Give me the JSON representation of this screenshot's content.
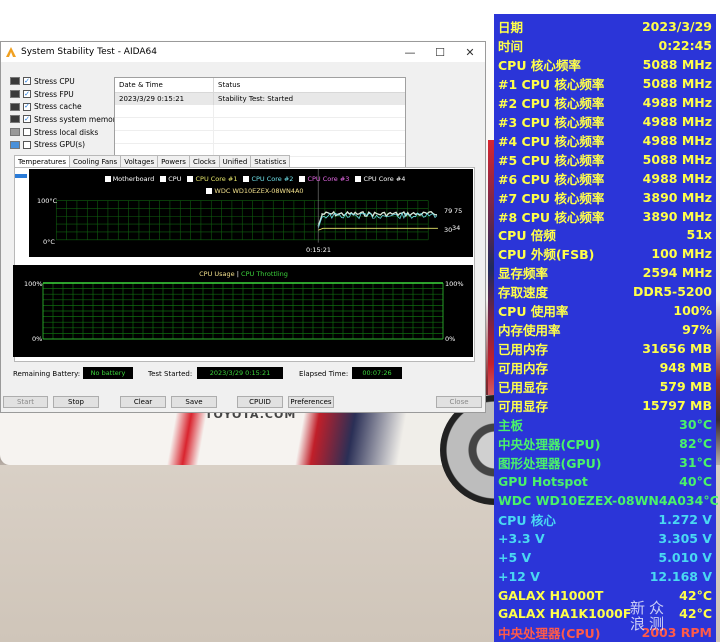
{
  "window": {
    "title": "System Stability Test - AIDA64",
    "controls": [
      "—",
      "☐",
      "✕"
    ]
  },
  "stress_options": [
    {
      "label": "Stress CPU",
      "checked": true,
      "icon": "cpu-chip-icon"
    },
    {
      "label": "Stress FPU",
      "checked": true,
      "icon": "fpu-chip-icon"
    },
    {
      "label": "Stress cache",
      "checked": true,
      "icon": "cache-chip-icon"
    },
    {
      "label": "Stress system memory",
      "checked": true,
      "icon": "memory-module-icon"
    },
    {
      "label": "Stress local disks",
      "checked": false,
      "icon": "disk-drive-icon"
    },
    {
      "label": "Stress GPU(s)",
      "checked": false,
      "icon": "monitor-icon"
    }
  ],
  "status_table": {
    "col_datetime": "Date & Time",
    "col_status": "Status",
    "rows": [
      {
        "datetime": "2023/3/29 0:15:21",
        "status": "Stability Test: Started"
      }
    ]
  },
  "tabs": [
    "Temperatures",
    "Cooling Fans",
    "Voltages",
    "Powers",
    "Clocks",
    "Unified",
    "Statistics"
  ],
  "temp_graph": {
    "legend": [
      {
        "label": "Motherboard",
        "color": "#ffffff"
      },
      {
        "label": "CPU",
        "color": "#ffffff"
      },
      {
        "label": "CPU Core #1",
        "color": "#e8e86a"
      },
      {
        "label": "CPU Core #2",
        "color": "#6ee0e8"
      },
      {
        "label": "CPU Core #3",
        "color": "#e86ae8"
      },
      {
        "label": "CPU Core #4",
        "color": "#ffffff"
      }
    ],
    "legend2": "WDC WD10EZEX-08WN4A0",
    "y_top": "100°C",
    "y_bottom": "0°C",
    "x_label": "0:15:21",
    "right_values": [
      "79",
      "75",
      "30",
      "34"
    ]
  },
  "usage_graph": {
    "legend_usage": "CPU Usage",
    "separator": "|",
    "legend_throttle": "CPU Throttling",
    "y_top_left": "100%",
    "y_bottom_left": "0%",
    "y_top_right": "100%",
    "y_bottom_right": "0%"
  },
  "bottom": {
    "battery_label": "Remaining Battery:",
    "battery_value": "No battery",
    "started_label": "Test Started:",
    "started_value": "2023/3/29 0:15:21",
    "elapsed_label": "Elapsed Time:",
    "elapsed_value": "00:07:26"
  },
  "buttons": {
    "start": "Start",
    "stop": "Stop",
    "clear": "Clear",
    "save": "Save",
    "cpuid": "CPUID",
    "preferences": "Preferences",
    "close": "Close"
  },
  "wallpaper_logo": "TOYOTA.COM",
  "osd": [
    {
      "key": "日期",
      "value": "2023/3/29",
      "color": "#ffff4a"
    },
    {
      "key": "时间",
      "value": "0:22:45",
      "color": "#ffff4a"
    },
    {
      "key": "CPU 核心频率",
      "value": "5088 MHz",
      "color": "#ffff4a"
    },
    {
      "key": "#1 CPU 核心频率",
      "value": "5088 MHz",
      "color": "#ffff4a"
    },
    {
      "key": "#2 CPU 核心频率",
      "value": "4988 MHz",
      "color": "#ffff4a"
    },
    {
      "key": "#3 CPU 核心频率",
      "value": "4988 MHz",
      "color": "#ffff4a"
    },
    {
      "key": "#4 CPU 核心频率",
      "value": "4988 MHz",
      "color": "#ffff4a"
    },
    {
      "key": "#5 CPU 核心频率",
      "value": "5088 MHz",
      "color": "#ffff4a"
    },
    {
      "key": "#6 CPU 核心频率",
      "value": "4988 MHz",
      "color": "#ffff4a"
    },
    {
      "key": "#7 CPU 核心频率",
      "value": "3890 MHz",
      "color": "#ffff4a"
    },
    {
      "key": "#8 CPU 核心频率",
      "value": "3890 MHz",
      "color": "#ffff4a"
    },
    {
      "key": "CPU 倍频",
      "value": "51x",
      "color": "#ffff4a"
    },
    {
      "key": "CPU 外频(FSB)",
      "value": "100 MHz",
      "color": "#ffff4a"
    },
    {
      "key": "显存频率",
      "value": "2594 MHz",
      "color": "#ffff4a"
    },
    {
      "key": "存取速度",
      "value": "DDR5-5200",
      "color": "#ffff4a"
    },
    {
      "key": "CPU 使用率",
      "value": "100%",
      "color": "#ffff4a"
    },
    {
      "key": "内存使用率",
      "value": "97%",
      "color": "#ffff4a"
    },
    {
      "key": "已用内存",
      "value": "31656 MB",
      "color": "#ffff4a"
    },
    {
      "key": "可用内存",
      "value": "948 MB",
      "color": "#ffff4a"
    },
    {
      "key": "已用显存",
      "value": "579 MB",
      "color": "#ffff4a"
    },
    {
      "key": "可用显存",
      "value": "15797 MB",
      "color": "#ffff4a"
    },
    {
      "key": "主板",
      "value": "30°C",
      "color": "#4af26a"
    },
    {
      "key": "中央处理器(CPU)",
      "value": "82°C",
      "color": "#4af26a"
    },
    {
      "key": "图形处理器(GPU)",
      "value": "31°C",
      "color": "#4af26a"
    },
    {
      "key": "GPU Hotspot",
      "value": "40°C",
      "color": "#4af26a"
    },
    {
      "key": "WDC WD10EZEX-08WN4A0",
      "value": "34°C",
      "color": "#4af26a"
    },
    {
      "key": "CPU 核心",
      "value": "1.272 V",
      "color": "#4ad8f2"
    },
    {
      "key": "+3.3 V",
      "value": "3.305 V",
      "color": "#4ad8f2"
    },
    {
      "key": "+5 V",
      "value": "5.010 V",
      "color": "#4ad8f2"
    },
    {
      "key": "+12 V",
      "value": "12.168 V",
      "color": "#4ad8f2"
    },
    {
      "key": "GALAX H1000T",
      "value": "42°C",
      "color": "#ffff4a"
    },
    {
      "key": "GALAX HA1K1000F",
      "value": "42°C",
      "color": "#ffff4a"
    },
    {
      "key": "中央处理器(CPU)",
      "value": "2003 RPM",
      "color": "#ff5a4a"
    }
  ],
  "watermark": [
    "新",
    "浪",
    "众",
    "测"
  ]
}
